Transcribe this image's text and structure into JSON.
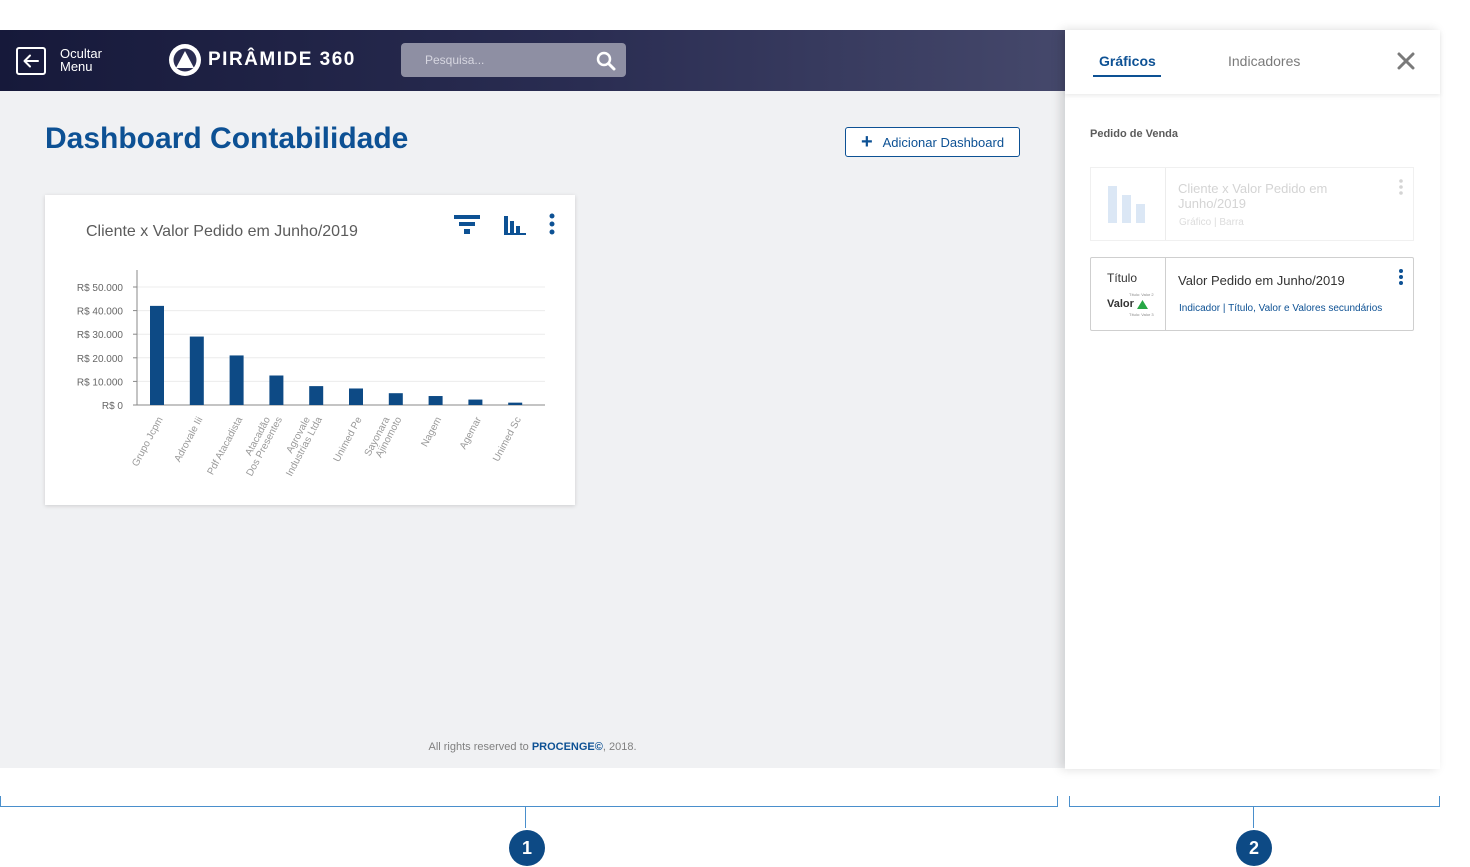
{
  "header": {
    "menu_toggle_label": "Ocultar Menu",
    "logo_text": "PIRÂMIDE 360",
    "search_placeholder": "Pesquisa..."
  },
  "page": {
    "title": "Dashboard Contabilidade",
    "add_button_label": "Adicionar Dashboard"
  },
  "widget": {
    "title": "Cliente x Valor Pedido em Junho/2019"
  },
  "chart_data": {
    "type": "bar",
    "title": "Cliente x Valor Pedido em Junho/2019",
    "categories": [
      "Grupo Jcpm",
      "Adrovale Iii",
      "Pdf Atacadista",
      "Atacadão Dos Presentes",
      "Agrovale Industrias Ltda",
      "Unimed Pe",
      "Sayonara Ajinomoto",
      "Nagem",
      "Agemar",
      "Unimed Sc"
    ],
    "category_lines": [
      [
        "Grupo Jcpm"
      ],
      [
        "Adrovale Iii"
      ],
      [
        "Pdf Atacadista"
      ],
      [
        "Atacadão",
        "Dos Presentes"
      ],
      [
        "Agrovale",
        "Industrias Ltda"
      ],
      [
        "Unimed Pe"
      ],
      [
        "Sayonara",
        "Ajinomoto"
      ],
      [
        "Nagem"
      ],
      [
        "Agemar"
      ],
      [
        "Unimed Sc"
      ]
    ],
    "values": [
      42000,
      29000,
      21000,
      12500,
      8000,
      7000,
      5000,
      3800,
      2300,
      1000
    ],
    "yticks": [
      "R$ 0",
      "R$ 10.000",
      "R$ 20.000",
      "R$ 30.000",
      "R$ 40.000",
      "R$ 50.000"
    ],
    "ytick_values": [
      0,
      10000,
      20000,
      30000,
      40000,
      50000
    ],
    "ylim": [
      0,
      50000
    ],
    "xlabel": "",
    "ylabel": "",
    "grid": true,
    "bar_color": "#0d4a85"
  },
  "footer": {
    "prefix": "All rights reserved to ",
    "brand": "PROCENGE©",
    "suffix": ", 2018."
  },
  "panel": {
    "tabs": [
      {
        "label": "Gráficos",
        "active": true
      },
      {
        "label": "Indicadores",
        "active": false
      }
    ],
    "section_label": "Pedido de Venda",
    "items": [
      {
        "title": "Cliente x Valor Pedido em Junho/2019",
        "subtitle": "Gráfico | Barra",
        "state": "disabled"
      },
      {
        "title": "Valor Pedido em Junho/2019",
        "subtitle": "Indicador | Título, Valor e Valores secundários",
        "state": "enabled",
        "thumb": {
          "title": "Título",
          "value": "Valor",
          "secondary_1": "Título: Valor 2",
          "secondary_2": "Título: Valor 3"
        }
      }
    ]
  },
  "annotations": {
    "marker_1": "1",
    "marker_2": "2"
  },
  "colors": {
    "brand": "#0d5194",
    "bar": "#0d4a85",
    "header_dark": "#16193a",
    "positive": "#27a745"
  }
}
